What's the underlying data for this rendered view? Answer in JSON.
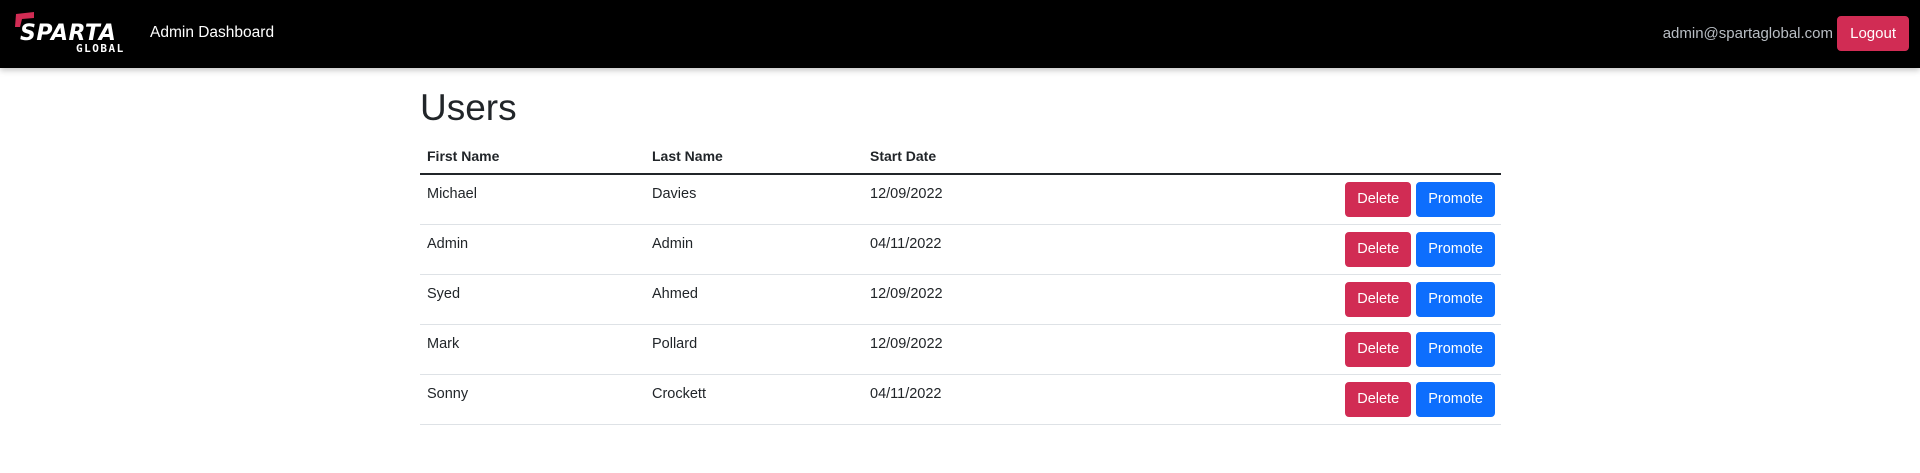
{
  "navbar": {
    "logo": {
      "line1": "SPARTA",
      "line2": "GLOBAL",
      "accent_color": "#d12c54"
    },
    "title": "Admin Dashboard",
    "user_email": "admin@spartaglobal.com",
    "logout_label": "Logout"
  },
  "main": {
    "title": "Users",
    "table": {
      "headers": [
        "First Name",
        "Last Name",
        "Start Date",
        ""
      ],
      "rows": [
        {
          "first_name": "Michael",
          "last_name": "Davies",
          "start_date": "12/09/2022"
        },
        {
          "first_name": "Admin",
          "last_name": "Admin",
          "start_date": "04/11/2022"
        },
        {
          "first_name": "Syed",
          "last_name": "Ahmed",
          "start_date": "12/09/2022"
        },
        {
          "first_name": "Mark",
          "last_name": "Pollard",
          "start_date": "12/09/2022"
        },
        {
          "first_name": "Sonny",
          "last_name": "Crockett",
          "start_date": "04/11/2022"
        }
      ],
      "delete_label": "Delete",
      "promote_label": "Promote"
    }
  },
  "colors": {
    "navbar_bg": "#000000",
    "danger": "#d12c54",
    "primary": "#0d6efd"
  }
}
